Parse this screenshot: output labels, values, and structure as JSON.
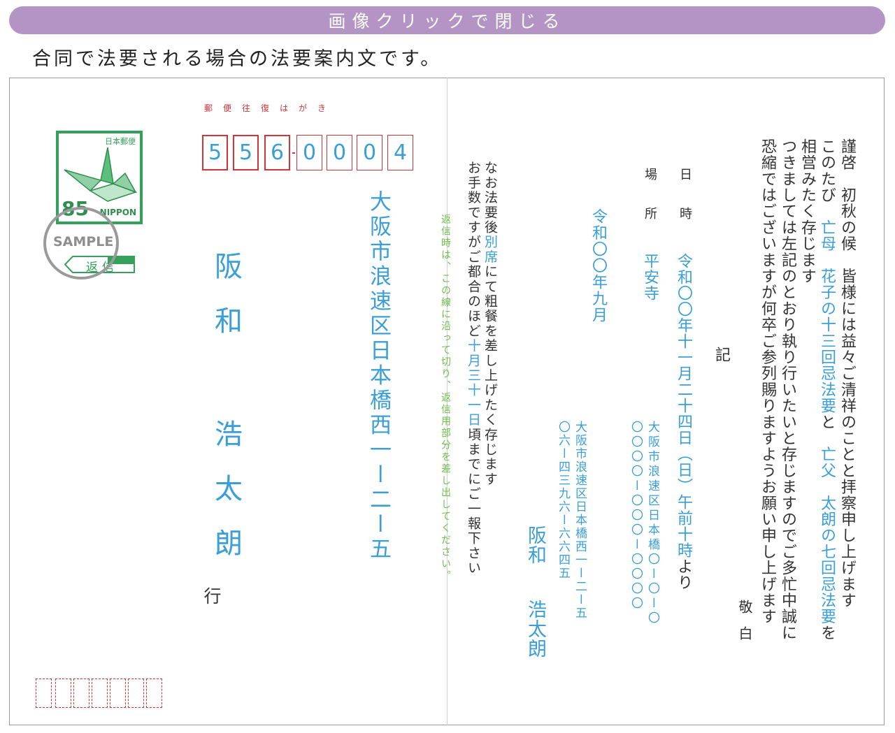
{
  "close_bar": {
    "label": "画像クリックで閉じる"
  },
  "intro": "合同で法要される場合の法要案内文です。",
  "address_side": {
    "header_label": "郵便往復はがき",
    "postal_digits": [
      "5",
      "5",
      "6",
      "0",
      "0",
      "0",
      "4"
    ],
    "stamp": {
      "country_jp": "日本郵便",
      "value": "85",
      "country_en": "NIPPON"
    },
    "reply_badge": "返信",
    "sample_mark": "SAMPLE",
    "address": "大阪市浪速区日本橋西一ー二ー五",
    "name_surname": "阪和",
    "name_given": "浩太朗",
    "suffix": "行"
  },
  "cut_note": "返信時は、この線に沿って切り、返信用部分を差し出してください。",
  "letter": {
    "col1": [
      "謹啓　初秋の候　皆様には益々ご清祥のことと拝察申し上げます",
      ""
    ],
    "col2": [
      "このたび　",
      "亡母　花子の十三回忌法要",
      "と　",
      "亡父　太朗の七回忌法要",
      "を"
    ],
    "col3": "相営みたく存じます",
    "col4": "つきましては左記のとおり執り行いたいと存じますのでご多忙中誠に",
    "col5": "恐縮ではございますが何卒ご参列賜りますようお願い申し上げます",
    "closing": "敬白",
    "ki": "記",
    "date_label": "日　時",
    "date_value": "令和〇〇年十一月二十四日（日）午前十時",
    "date_suffix": "より",
    "place_label": "場　所",
    "place_value": "平安寺",
    "place_address": "大阪市浪速区日本橋〇ー〇ー〇",
    "place_phone": "〇〇〇〇ー〇〇〇ー〇〇〇〇",
    "sender_date": "令和〇〇年九月",
    "sender_address": "大阪市浪速区日本橋西一ー二ー五",
    "sender_phone": "〇六ー四三九六ー六六四五",
    "sender_name_surname": "阪和",
    "sender_name_given": "浩太朗",
    "note1_parts": [
      "なお法要後",
      "別席",
      "にて粗餐を差し上げたく存じます"
    ],
    "note2_parts": [
      "お手数ですがご都合のほど",
      "十月三十一日",
      "頃までにご一報下さい"
    ]
  }
}
